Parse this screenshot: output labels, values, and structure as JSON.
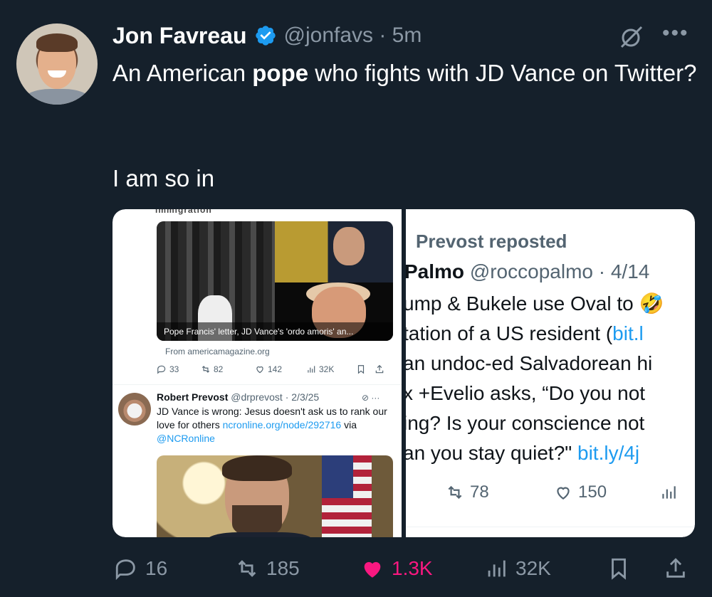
{
  "author": {
    "name": "Jon Favreau",
    "handle_time": "@jonfavs · 5m"
  },
  "tweet": {
    "text_before": "An American ",
    "text_bold": "pope",
    "text_after": " who fights with JD Vance on Twitter?",
    "text_second": "I am so in"
  },
  "media_left": {
    "top_word": "immigration",
    "article_caption": "Pope Francis' letter, JD Vance's 'ordo amoris' an...",
    "article_source": "From americamagazine.org",
    "metrics": {
      "replies": "33",
      "reposts": "82",
      "likes": "142",
      "views": "32K"
    },
    "reply_tweet": {
      "name": "Robert Prevost",
      "handle_time": "@drprevost · 2/3/25",
      "text_main": "JD Vance is wrong: Jesus doesn't ask us to rank our love for others ",
      "link": "ncronline.org/node/292716",
      "via": " via ",
      "mention": "@NCRonline"
    }
  },
  "media_right": {
    "reposted_label": "Prevost reposted",
    "name": "Palmo",
    "handle_time": "@roccopalmo · 4/14",
    "line1": "ump & Bukele use Oval to 🤣",
    "line2_text": "tation of a US resident (",
    "line2_link": "bit.l",
    "line3": "an undoc-ed Salvadorean hi",
    "line4": "x +Evelio asks, “Do you not",
    "line5": "ing? Is your conscience not",
    "line6_text": "an you stay quiet?\" ",
    "line6_link": "bit.ly/4j",
    "metrics": {
      "reposts": "78",
      "likes": "150"
    }
  },
  "actions": {
    "replies": "16",
    "reposts": "185",
    "likes": "1.3K",
    "views": "32K"
  },
  "colors": {
    "background": "#15202b",
    "verified": "#1d9bf0",
    "like": "#f91880",
    "muted": "#8b98a5"
  }
}
